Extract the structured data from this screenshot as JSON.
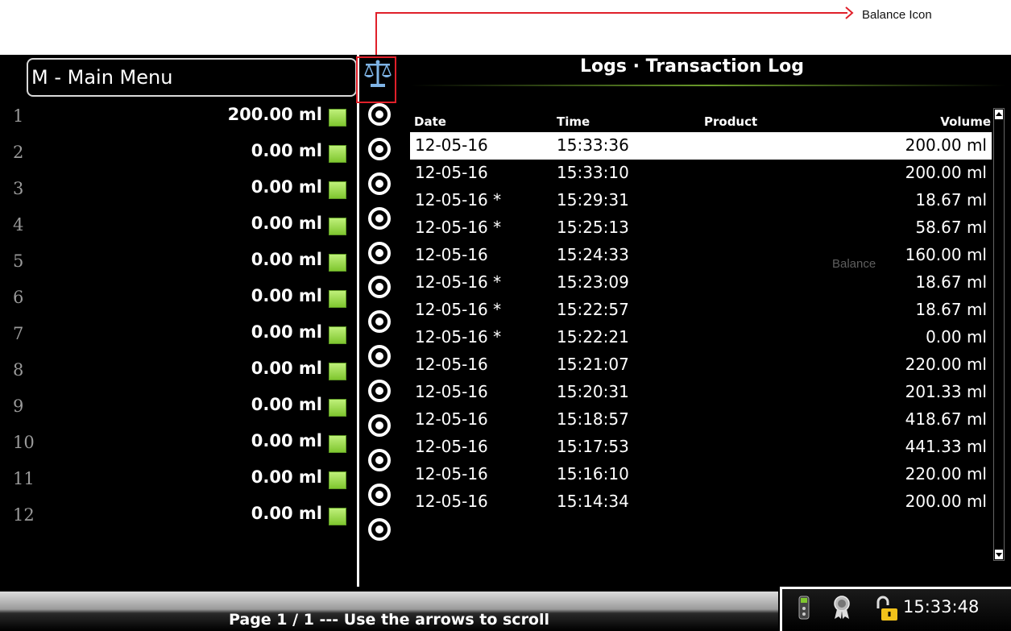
{
  "annotation": {
    "label": "Balance Icon"
  },
  "left_panel": {
    "menu_title": "M - Main Menu",
    "meters": [
      {
        "num": "1",
        "value": "200.00 ml"
      },
      {
        "num": "2",
        "value": "0.00 ml"
      },
      {
        "num": "3",
        "value": "0.00 ml"
      },
      {
        "num": "4",
        "value": "0.00 ml"
      },
      {
        "num": "5",
        "value": "0.00 ml"
      },
      {
        "num": "6",
        "value": "0.00 ml"
      },
      {
        "num": "7",
        "value": "0.00 ml"
      },
      {
        "num": "8",
        "value": "0.00 ml"
      },
      {
        "num": "9",
        "value": "0.00 ml"
      },
      {
        "num": "10",
        "value": "0.00 ml"
      },
      {
        "num": "11",
        "value": "0.00 ml"
      },
      {
        "num": "12",
        "value": "0.00 ml"
      }
    ],
    "led_color": "#8fd63a"
  },
  "log": {
    "title": "Logs · Transaction Log",
    "headers": {
      "date": "Date",
      "time": "Time",
      "product": "Product",
      "volume": "Volume"
    },
    "rows": [
      {
        "date": "12-05-16",
        "time": "15:33:36",
        "volume": "200.00 ml",
        "selected": true
      },
      {
        "date": "12-05-16",
        "time": "15:33:10",
        "volume": "200.00 ml"
      },
      {
        "date": "12-05-16 *",
        "time": "15:29:31",
        "volume": "18.67 ml"
      },
      {
        "date": "12-05-16 *",
        "time": "15:25:13",
        "volume": "58.67 ml"
      },
      {
        "date": "12-05-16",
        "time": "15:24:33",
        "volume": "160.00 ml"
      },
      {
        "date": "12-05-16 *",
        "time": "15:23:09",
        "volume": "18.67 ml"
      },
      {
        "date": "12-05-16 *",
        "time": "15:22:57",
        "volume": "18.67 ml"
      },
      {
        "date": "12-05-16 *",
        "time": "15:22:21",
        "volume": "0.00 ml"
      },
      {
        "date": "12-05-16",
        "time": "15:21:07",
        "volume": "220.00 ml"
      },
      {
        "date": "12-05-16",
        "time": "15:20:31",
        "volume": "201.33 ml"
      },
      {
        "date": "12-05-16",
        "time": "15:18:57",
        "volume": "418.67 ml"
      },
      {
        "date": "12-05-16",
        "time": "15:17:53",
        "volume": "441.33 ml"
      },
      {
        "date": "12-05-16",
        "time": "15:16:10",
        "volume": "220.00 ml"
      },
      {
        "date": "12-05-16",
        "time": "15:14:34",
        "volume": "200.00 ml"
      }
    ],
    "ghost_label": "Balance"
  },
  "footer": {
    "message": "Page 1 / 1 --- Use the arrows to scroll",
    "time": "15:33:48"
  },
  "icons": [
    "balance-icon",
    "radio-icon",
    "remote-icon",
    "award-badge-icon",
    "lock-icon"
  ],
  "colors": {
    "annotation": "#e0202a",
    "accent_line": "#6a9b2a",
    "lock": "#f2c21a"
  }
}
